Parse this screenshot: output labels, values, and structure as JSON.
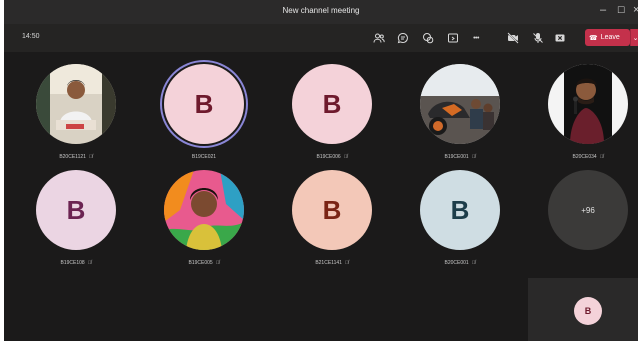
{
  "window": {
    "title": "New channel meeting",
    "controls": {
      "minimize": "–",
      "maximize": "☐",
      "close": "×"
    }
  },
  "toolbar": {
    "time": "14:50",
    "icons": [
      "participants-icon",
      "chat-icon",
      "reactions-icon",
      "share-tray-icon",
      "more-icon",
      "camera-off-icon",
      "mic-off-icon",
      "share-screen-icon"
    ],
    "more_glyph": "•••",
    "leave_label": "Leave",
    "leave_caret": "⌄"
  },
  "colors": {
    "leave": "#c4314b",
    "speaking_ring": "#8a86d6",
    "avatar_pink_bg": "#f4d2d9",
    "avatar_pink_fg": "#6e1a2d",
    "avatar_purple_bg": "#ebd5e3",
    "avatar_purple_fg": "#6b2352",
    "avatar_peach_bg": "#f3c8b8",
    "avatar_peach_fg": "#7a2414",
    "avatar_blue_bg": "#cfdde3",
    "avatar_blue_fg": "#1d3d4a",
    "overflow_bg": "#3b3a39"
  },
  "participants": [
    {
      "name": "B20CE1121",
      "type": "photo",
      "photo": "student-at-desk"
    },
    {
      "name": "B19CE021",
      "type": "initial",
      "initial": "B",
      "speaking": true
    },
    {
      "name": "B19CE006",
      "type": "initial",
      "initial": "B"
    },
    {
      "name": "B19CE001",
      "type": "photo",
      "photo": "people-with-motorbike"
    },
    {
      "name": "B20CE034",
      "type": "photo",
      "photo": "man-with-microphone"
    },
    {
      "name": "B19CE108",
      "type": "initial",
      "initial": "B"
    },
    {
      "name": "B19CE005",
      "type": "photo",
      "photo": "girl-portrait"
    },
    {
      "name": "B21CE1141",
      "type": "initial",
      "initial": "B"
    },
    {
      "name": "B20CE001",
      "type": "initial",
      "initial": "B"
    }
  ],
  "overflow": {
    "label": "+96"
  },
  "self_view": {
    "initial": "B"
  }
}
